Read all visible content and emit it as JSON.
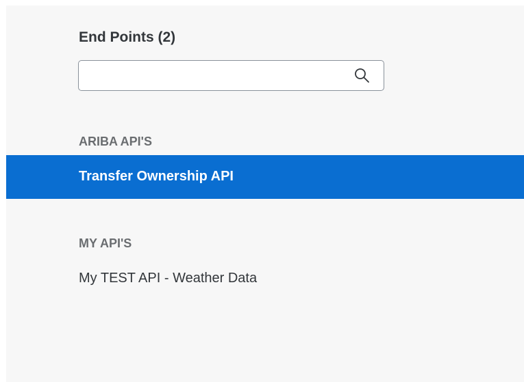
{
  "endpoints_panel": {
    "title": "End Points (2)",
    "search": {
      "value": "",
      "placeholder": "",
      "icon": "search-icon"
    },
    "groups": [
      {
        "header": "ARIBA API'S",
        "items": [
          {
            "label": "Transfer Ownership API",
            "selected": true
          }
        ]
      },
      {
        "header": "MY API'S",
        "items": [
          {
            "label": "My TEST API - Weather Data",
            "selected": false
          }
        ]
      }
    ]
  },
  "colors": {
    "panel_background": "#f7f7f7",
    "selected_background": "#0a6ed1",
    "selected_text": "#ffffff",
    "title_text": "#32363a",
    "group_header_text": "#6a6d70",
    "search_border": "#89919a"
  }
}
